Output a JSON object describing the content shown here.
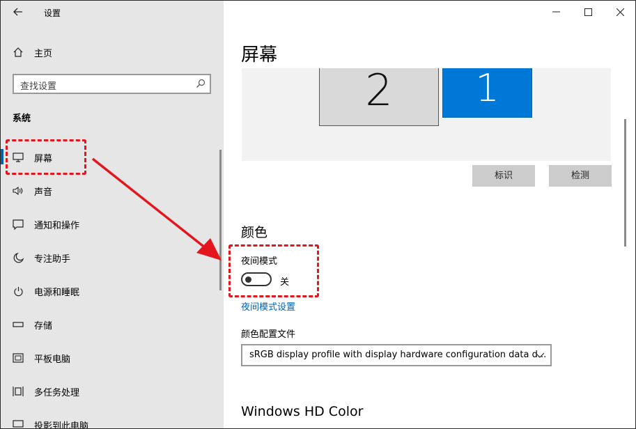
{
  "window": {
    "title": "设置",
    "back_icon": "arrow-left-icon",
    "controls": [
      "minimize-icon",
      "maximize-icon",
      "close-icon"
    ]
  },
  "sidebar": {
    "home_label": "主页",
    "search_placeholder": "查找设置",
    "section_title": "系统",
    "items": [
      {
        "label": "屏幕",
        "icon": "monitor-icon",
        "active": true
      },
      {
        "label": "声音",
        "icon": "speaker-icon"
      },
      {
        "label": "通知和操作",
        "icon": "notification-icon"
      },
      {
        "label": "专注助手",
        "icon": "moon-icon"
      },
      {
        "label": "电源和睡眠",
        "icon": "power-icon"
      },
      {
        "label": "存储",
        "icon": "storage-icon"
      },
      {
        "label": "平板电脑",
        "icon": "tablet-icon"
      },
      {
        "label": "多任务处理",
        "icon": "multitask-icon"
      },
      {
        "label": "投影到此电脑",
        "icon": "projection-icon"
      }
    ]
  },
  "main": {
    "title": "屏幕",
    "monitors": [
      {
        "number": "2",
        "selected": false
      },
      {
        "number": "1",
        "selected": true
      }
    ],
    "identify_button": "标识",
    "detect_button": "检测",
    "color_heading": "颜色",
    "night_mode_label": "夜间模式",
    "night_mode_state": "关",
    "night_mode_settings_link": "夜间模式设置",
    "color_profile_label": "颜色配置文件",
    "color_profile_value": "sRGB display profile with display hardware configuration data d...",
    "hd_color_heading": "Windows HD Color"
  },
  "colors": {
    "accent": "#0078d7",
    "link": "#0063b1",
    "annotation": "#e3161d",
    "sidebar_bg": "#e6e6e6"
  }
}
